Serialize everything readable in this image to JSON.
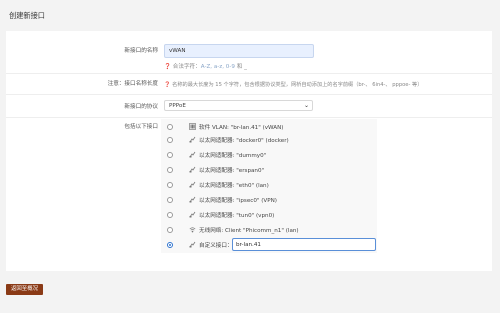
{
  "page": {
    "title": "创建新接口"
  },
  "form": {
    "name_label": "新接口的名称",
    "name_value": "vWAN",
    "name_hint": "合法字符：",
    "name_hint_chars": "A-Z, a-z, 0-9",
    "name_hint_end": " 和 _",
    "note_label": "注意：接口名称长度",
    "note_text": "名称的最大长度为 15 个字符，包含根据协议类型，网桥自动添加上的名字前缀（br-、 6in4-、 pppoe- 等）",
    "protocol_label": "新接口的协议",
    "protocol_value": "PPPoE",
    "include_label": "包括以下接口",
    "interfaces": [
      {
        "text": "软件 VLAN: \"br-lan.41\" (vWAN)",
        "icon": "vlan-icon",
        "checked": false
      },
      {
        "text": "以太网适配器: \"docker0\" (docker)",
        "icon": "ethernet-port-icon",
        "checked": false
      },
      {
        "text": "以太网适配器: \"dummy0\"",
        "icon": "ethernet-port-icon",
        "checked": false
      },
      {
        "text": "以太网适配器: \"erspan0\"",
        "icon": "ethernet-port-icon",
        "checked": false
      },
      {
        "text": "以太网适配器: \"eth0\" (lan)",
        "icon": "ethernet-port-icon",
        "checked": false
      },
      {
        "text": "以太网适配器: \"ipsec0\" (VPN)",
        "icon": "ethernet-port-icon",
        "checked": false
      },
      {
        "text": "以太网适配器: \"tun0\" (vpn0)",
        "icon": "ethernet-port-icon",
        "checked": false
      },
      {
        "text": "无线网络: Client \"Phicomm_n1\" (lan)",
        "icon": "wifi-icon",
        "checked": false
      },
      {
        "text": "自定义接口：",
        "icon": "ethernet-port-icon",
        "checked": true
      }
    ],
    "custom_value": "br-lan.41"
  },
  "actions": {
    "back_label": "返回至概况"
  },
  "colors": {
    "accent": "#2f74d0",
    "back_button": "#8a3a16",
    "input_fill": "#e8f0fe"
  }
}
